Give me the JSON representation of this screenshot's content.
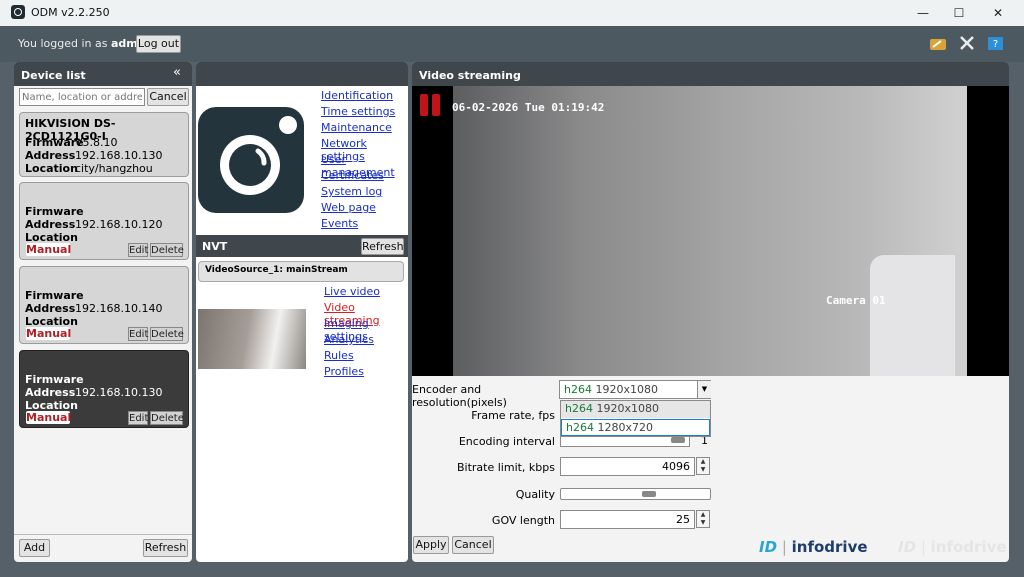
{
  "window": {
    "title": "ODM v2.2.250",
    "minimize": "—",
    "maximize": "☐",
    "close": "✕"
  },
  "session": {
    "prefix": "You logged in as",
    "user": "admin",
    "logout_label": "Log out"
  },
  "toolbar_icons": [
    "settings-wrench-icon",
    "tools-icon",
    "help-book-icon"
  ],
  "device_list": {
    "title": "Device list",
    "collapse": "«",
    "search_placeholder": "Name, location or address",
    "cancel_label": "Cancel",
    "add_label": "Add",
    "refresh_label": "Refresh",
    "devices": [
      {
        "name": "HIKVISION DS-2CD1121G0-I",
        "firmware_label": "Firmware",
        "firmware": "V5.8.10",
        "address_label": "Address",
        "address": "192.168.10.130",
        "location_label": "Location",
        "location": "city/hangzhou"
      },
      {
        "name": "",
        "firmware_label": "Firmware",
        "address_label": "Address",
        "address": "192.168.10.120",
        "location_label": "Location",
        "manual": "Manual",
        "edit": "Edit",
        "delete": "Delete"
      },
      {
        "name": "",
        "firmware_label": "Firmware",
        "address_label": "Address",
        "address": "192.168.10.140",
        "location_label": "Location",
        "manual": "Manual",
        "edit": "Edit",
        "delete": "Delete"
      },
      {
        "name": "",
        "firmware_label": "Firmware",
        "address_label": "Address",
        "address": "192.168.10.130",
        "location_label": "Location",
        "manual": "Manual",
        "edit": "Edit",
        "delete": "Delete",
        "selected": true
      }
    ]
  },
  "device_menu": [
    "Identification",
    "Time settings",
    "Maintenance",
    "Network settings",
    "User management",
    "Certificates",
    "System log",
    "Web page",
    "Events"
  ],
  "nvt": {
    "title": "NVT",
    "refresh_label": "Refresh",
    "source": "VideoSource_1: mainStream",
    "links": [
      "Live video",
      "Video streaming",
      "Imaging settings",
      "Analytics",
      "Rules",
      "Profiles"
    ],
    "active_link": "Video streaming"
  },
  "video": {
    "title": "Video streaming",
    "osd_time": "06-02-2026 Tue 01:19:42",
    "osd_camera": "Camera 01"
  },
  "settings": {
    "encoder_label": "Encoder and resolution(pixels)",
    "encoder_selected": {
      "codec": "h264",
      "res": "1920x1080"
    },
    "encoder_options": [
      {
        "codec": "h264",
        "res": "1920x1080"
      },
      {
        "codec": "h264",
        "res": "1280x720"
      }
    ],
    "framerate_label": "Frame rate, fps",
    "interval_label": "Encoding interval",
    "interval_value": "1",
    "bitrate_label": "Bitrate limit, kbps",
    "bitrate_value": "4096",
    "quality_label": "Quality",
    "quality_level": 0.6,
    "gov_label": "GOV length",
    "gov_value": "25",
    "apply_label": "Apply",
    "cancel_label": "Cancel"
  },
  "brand": {
    "mark": "ID",
    "name": "infodrive"
  },
  "colors": {
    "accent_link": "#1a2fc7",
    "active_link": "#d62020",
    "manual_text": "#b01f24",
    "codec_text": "#1a7a3a",
    "panel_header": "#3f474c"
  }
}
